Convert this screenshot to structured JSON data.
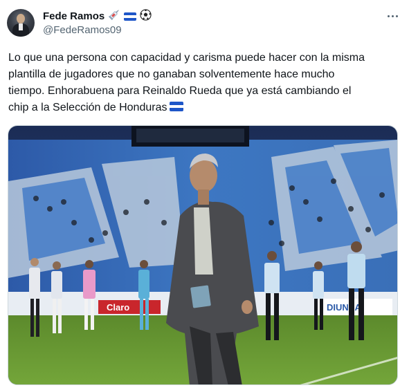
{
  "author": {
    "display_name": "Fede Ramos",
    "handle": "@FedeRamos09",
    "badges": [
      "syringe-emoji",
      "honduras-flag-emoji",
      "soccer-ball-emoji"
    ]
  },
  "menu": {
    "icon": "more-icon"
  },
  "tweet": {
    "lines": [
      "Lo que una persona con capacidad y carisma puede hacer con la misma",
      "plantilla de jugadores que no ganaban solventemente hace mucho",
      "tiempo. Enhorabuena para Reinaldo Rueda que ya está cambiando el",
      "chip  a la Selección de Honduras"
    ],
    "trailing_emoji": "honduras-flag-emoji"
  },
  "media": {
    "description_icon": "photo",
    "ad_boards": [
      "Claro",
      "DIUNSA"
    ]
  },
  "colors": {
    "text": "#0f1419",
    "secondary": "#536471",
    "flag_blue": "#1e56c8"
  }
}
